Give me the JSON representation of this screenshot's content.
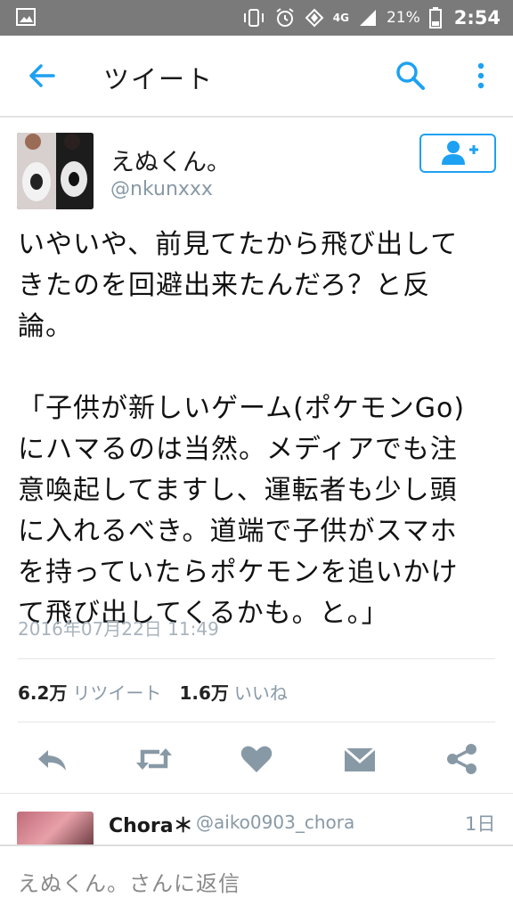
{
  "status_bar": {
    "network": "4G",
    "battery": "21%",
    "time": "2:54"
  },
  "app_bar": {
    "title": "ツイート",
    "icons": [
      "back-arrow-icon",
      "search-icon",
      "more-vert-icon"
    ]
  },
  "tweet": {
    "display_name": "えぬくん。",
    "handle": "@nkunxxx",
    "text": "いやいや、前見てたから飛び出して\nきたのを回避出来たんだろ？と反\n論。\n\n「子供が新しいゲーム(ポケモンGo)\nにハマるのは当然。メディアでも注\n意喚起してますし、運転者も少し頭\nに入れるべき。道端で子供がスマホ\nを持っていたらポケモンを追いかけ\nて飛び出してくるかも。と。」",
    "timestamp": "2016年07月22日 11:49",
    "retweet_count": "6.2万",
    "retweet_label": "リツイート",
    "like_count": "1.6万",
    "like_label": "いいね"
  },
  "actions": [
    "reply-icon",
    "retweet-icon",
    "heart-icon",
    "dm-envelope-icon",
    "share-icon"
  ],
  "reply_preview": {
    "name": "Chora＊",
    "handle": "@aiko0903_chora",
    "time": "1日"
  },
  "composer": {
    "placeholder": "えぬくん。さんに返信"
  },
  "colors": {
    "accent": "#1da1f2",
    "status_bar": "#7a7a7a",
    "muted_text": "#8899a6"
  }
}
